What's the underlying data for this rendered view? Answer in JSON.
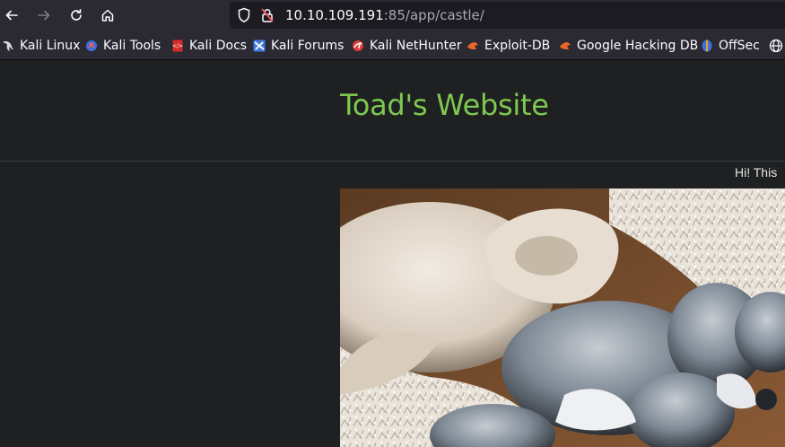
{
  "browser": {
    "url_host": "10.10.109.191",
    "url_rest": ":85/app/castle/",
    "bookmarks": [
      {
        "label": "Kali Linux",
        "icon": "kali-dragon-icon"
      },
      {
        "label": "Kali Tools",
        "icon": "kali-tools-icon"
      },
      {
        "label": "Kali Docs",
        "icon": "kali-docs-icon"
      },
      {
        "label": "Kali Forums",
        "icon": "kali-forums-icon"
      },
      {
        "label": "Kali NetHunter",
        "icon": "kali-nethunter-icon"
      },
      {
        "label": "Exploit-DB",
        "icon": "exploit-db-icon"
      },
      {
        "label": "Google Hacking DB",
        "icon": "ghdb-icon"
      },
      {
        "label": "OffSec",
        "icon": "offsec-icon"
      }
    ]
  },
  "page": {
    "title": "Toad's Website",
    "greeting": "Hi! This",
    "title_color": "#7ec850",
    "image": "mushrooms-photo"
  }
}
